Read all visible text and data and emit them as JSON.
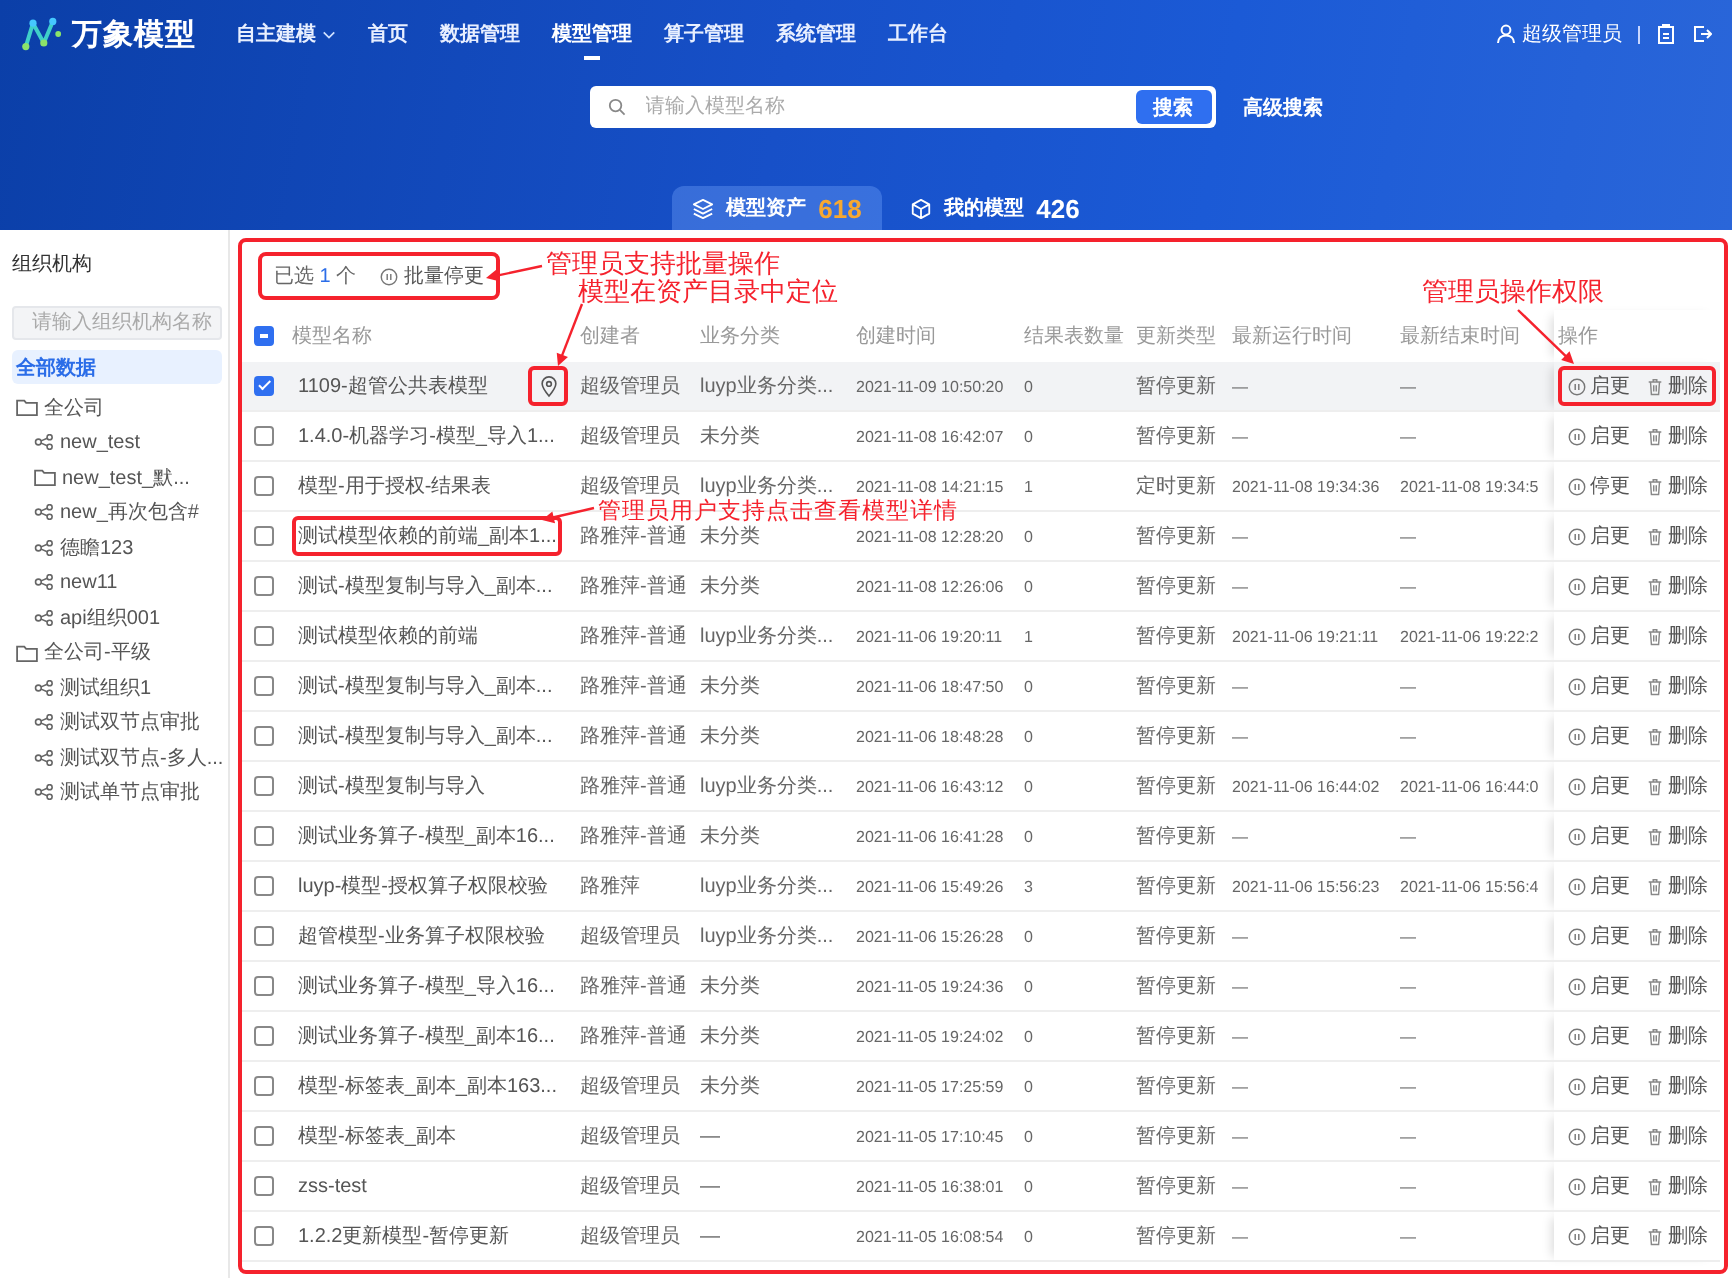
{
  "header": {
    "brand": "万象模型",
    "nav": [
      {
        "label": "自主建模",
        "dropdown": true,
        "selected": false
      },
      {
        "label": "首页",
        "dropdown": false,
        "selected": false
      },
      {
        "label": "数据管理",
        "dropdown": false,
        "selected": false
      },
      {
        "label": "模型管理",
        "dropdown": false,
        "selected": true
      },
      {
        "label": "算子管理",
        "dropdown": false,
        "selected": false
      },
      {
        "label": "系统管理",
        "dropdown": false,
        "selected": false
      },
      {
        "label": "工作台",
        "dropdown": false,
        "selected": false
      }
    ],
    "user": "超级管理员"
  },
  "search": {
    "placeholder": "请输入模型名称",
    "button": "搜索",
    "advanced": "高级搜索"
  },
  "asset_tabs": [
    {
      "label": "模型资产",
      "count": "618",
      "selected": true
    },
    {
      "label": "我的模型",
      "count": "426",
      "selected": false
    }
  ],
  "sidebar": {
    "title": "组织机构",
    "search_placeholder": "请输入组织机构名称",
    "tree": [
      {
        "label": "全部数据",
        "kind": "all",
        "selected": true
      },
      {
        "label": "全公司",
        "kind": "folder",
        "selected": false,
        "children": [
          {
            "label": "new_test",
            "kind": "org",
            "selected": false
          },
          {
            "label": "new_test_默...",
            "kind": "folder",
            "selected": false
          },
          {
            "label": "new_再次包含#",
            "kind": "org",
            "selected": false
          },
          {
            "label": "德瞻123",
            "kind": "org",
            "selected": false
          },
          {
            "label": "new11",
            "kind": "org",
            "selected": false
          },
          {
            "label": "api组织001",
            "kind": "org",
            "selected": false
          }
        ]
      },
      {
        "label": "全公司-平级",
        "kind": "folder",
        "selected": false,
        "children": [
          {
            "label": "测试组织1",
            "kind": "org",
            "selected": false
          },
          {
            "label": "测试双节点审批",
            "kind": "org",
            "selected": false
          },
          {
            "label": "测试双节点-多人...",
            "kind": "org",
            "selected": false
          },
          {
            "label": "测试单节点审批",
            "kind": "org",
            "selected": false
          }
        ]
      }
    ]
  },
  "batch": {
    "prefix": "已选",
    "count": "1",
    "suffix": "个",
    "button": "批量停更",
    "highlighted": true
  },
  "table": {
    "select_all": {
      "indeterminate": true
    },
    "columns": [
      "模型名称",
      "创建者",
      "业务分类",
      "创建时间",
      "结果表数量",
      "更新类型",
      "最新运行时间",
      "最新结束时间",
      "操作"
    ],
    "rows": [
      {
        "selected": true,
        "name": "1109-超管公共表模型",
        "locate": true,
        "name_highlighted": false,
        "creator": "超级管理员",
        "category": "luyp业务分类...",
        "created": "2021-11-09 10:50:20",
        "result_count": "0",
        "update_type": "暂停更新",
        "last_run": "—",
        "last_end": "—",
        "actions": [
          "启更",
          "删除"
        ],
        "actions_highlighted": true
      },
      {
        "selected": false,
        "name": "1.4.0-机器学习-模型_导入1...",
        "locate": false,
        "name_highlighted": false,
        "creator": "超级管理员",
        "category": "未分类",
        "created": "2021-11-08 16:42:07",
        "result_count": "0",
        "update_type": "暂停更新",
        "last_run": "—",
        "last_end": "—",
        "actions": [
          "启更",
          "删除"
        ],
        "actions_highlighted": false
      },
      {
        "selected": false,
        "name": "模型-用于授权-结果表",
        "locate": false,
        "name_highlighted": false,
        "creator": "超级管理员",
        "category": "luyp业务分类...",
        "created": "2021-11-08 14:21:15",
        "result_count": "1",
        "update_type": "定时更新",
        "last_run": "2021-11-08 19:34:36",
        "last_end": "2021-11-08 19:34:5",
        "actions": [
          "停更",
          "删除"
        ],
        "actions_highlighted": false
      },
      {
        "selected": false,
        "name": "测试模型依赖的前端_副本1...",
        "locate": false,
        "name_highlighted": true,
        "creator": "路雅萍-普通",
        "category": "未分类",
        "created": "2021-11-08 12:28:20",
        "result_count": "0",
        "update_type": "暂停更新",
        "last_run": "—",
        "last_end": "—",
        "actions": [
          "启更",
          "删除"
        ],
        "actions_highlighted": false
      },
      {
        "selected": false,
        "name": "测试-模型复制与导入_副本...",
        "locate": false,
        "name_highlighted": false,
        "creator": "路雅萍-普通",
        "category": "未分类",
        "created": "2021-11-08 12:26:06",
        "result_count": "0",
        "update_type": "暂停更新",
        "last_run": "—",
        "last_end": "—",
        "actions": [
          "启更",
          "删除"
        ],
        "actions_highlighted": false
      },
      {
        "selected": false,
        "name": "测试模型依赖的前端",
        "locate": false,
        "name_highlighted": false,
        "creator": "路雅萍-普通",
        "category": "luyp业务分类...",
        "created": "2021-11-06 19:20:11",
        "result_count": "1",
        "update_type": "暂停更新",
        "last_run": "2021-11-06 19:21:11",
        "last_end": "2021-11-06 19:22:2",
        "actions": [
          "启更",
          "删除"
        ],
        "actions_highlighted": false
      },
      {
        "selected": false,
        "name": "测试-模型复制与导入_副本...",
        "locate": false,
        "name_highlighted": false,
        "creator": "路雅萍-普通",
        "category": "未分类",
        "created": "2021-11-06 18:47:50",
        "result_count": "0",
        "update_type": "暂停更新",
        "last_run": "—",
        "last_end": "—",
        "actions": [
          "启更",
          "删除"
        ],
        "actions_highlighted": false
      },
      {
        "selected": false,
        "name": "测试-模型复制与导入_副本...",
        "locate": false,
        "name_highlighted": false,
        "creator": "路雅萍-普通",
        "category": "未分类",
        "created": "2021-11-06 18:48:28",
        "result_count": "0",
        "update_type": "暂停更新",
        "last_run": "—",
        "last_end": "—",
        "actions": [
          "启更",
          "删除"
        ],
        "actions_highlighted": false
      },
      {
        "selected": false,
        "name": "测试-模型复制与导入",
        "locate": false,
        "name_highlighted": false,
        "creator": "路雅萍-普通",
        "category": "luyp业务分类...",
        "created": "2021-11-06 16:43:12",
        "result_count": "0",
        "update_type": "暂停更新",
        "last_run": "2021-11-06 16:44:02",
        "last_end": "2021-11-06 16:44:0",
        "actions": [
          "启更",
          "删除"
        ],
        "actions_highlighted": false
      },
      {
        "selected": false,
        "name": "测试业务算子-模型_副本16...",
        "locate": false,
        "name_highlighted": false,
        "creator": "路雅萍-普通",
        "category": "未分类",
        "created": "2021-11-06 16:41:28",
        "result_count": "0",
        "update_type": "暂停更新",
        "last_run": "—",
        "last_end": "—",
        "actions": [
          "启更",
          "删除"
        ],
        "actions_highlighted": false
      },
      {
        "selected": false,
        "name": "luyp-模型-授权算子权限校验",
        "locate": false,
        "name_highlighted": false,
        "creator": "路雅萍",
        "category": "luyp业务分类...",
        "created": "2021-11-06 15:49:26",
        "result_count": "3",
        "update_type": "暂停更新",
        "last_run": "2021-11-06 15:56:23",
        "last_end": "2021-11-06 15:56:4",
        "actions": [
          "启更",
          "删除"
        ],
        "actions_highlighted": false
      },
      {
        "selected": false,
        "name": "超管模型-业务算子权限校验",
        "locate": false,
        "name_highlighted": false,
        "creator": "超级管理员",
        "category": "luyp业务分类...",
        "created": "2021-11-06 15:26:28",
        "result_count": "0",
        "update_type": "暂停更新",
        "last_run": "—",
        "last_end": "—",
        "actions": [
          "启更",
          "删除"
        ],
        "actions_highlighted": false
      },
      {
        "selected": false,
        "name": "测试业务算子-模型_导入16...",
        "locate": false,
        "name_highlighted": false,
        "creator": "路雅萍-普通",
        "category": "未分类",
        "created": "2021-11-05 19:24:36",
        "result_count": "0",
        "update_type": "暂停更新",
        "last_run": "—",
        "last_end": "—",
        "actions": [
          "启更",
          "删除"
        ],
        "actions_highlighted": false
      },
      {
        "selected": false,
        "name": "测试业务算子-模型_副本16...",
        "locate": false,
        "name_highlighted": false,
        "creator": "路雅萍-普通",
        "category": "未分类",
        "created": "2021-11-05 19:24:02",
        "result_count": "0",
        "update_type": "暂停更新",
        "last_run": "—",
        "last_end": "—",
        "actions": [
          "启更",
          "删除"
        ],
        "actions_highlighted": false
      },
      {
        "selected": false,
        "name": "模型-标签表_副本_副本163...",
        "locate": false,
        "name_highlighted": false,
        "creator": "超级管理员",
        "category": "未分类",
        "created": "2021-11-05 17:25:59",
        "result_count": "0",
        "update_type": "暂停更新",
        "last_run": "—",
        "last_end": "—",
        "actions": [
          "启更",
          "删除"
        ],
        "actions_highlighted": false
      },
      {
        "selected": false,
        "name": "模型-标签表_副本",
        "locate": false,
        "name_highlighted": false,
        "creator": "超级管理员",
        "category": "—",
        "created": "2021-11-05 17:10:45",
        "result_count": "0",
        "update_type": "暂停更新",
        "last_run": "—",
        "last_end": "—",
        "actions": [
          "启更",
          "删除"
        ],
        "actions_highlighted": false
      },
      {
        "selected": false,
        "name": "zss-test",
        "locate": false,
        "name_highlighted": false,
        "creator": "超级管理员",
        "category": "—",
        "created": "2021-11-05 16:38:01",
        "result_count": "0",
        "update_type": "暂停更新",
        "last_run": "—",
        "last_end": "—",
        "actions": [
          "启更",
          "删除"
        ],
        "actions_highlighted": false
      },
      {
        "selected": false,
        "name": "1.2.2更新模型-暂停更新",
        "locate": false,
        "name_highlighted": false,
        "creator": "超级管理员",
        "category": "—",
        "created": "2021-11-05 16:08:54",
        "result_count": "0",
        "update_type": "暂停更新",
        "last_run": "—",
        "last_end": "—",
        "actions": [
          "启更",
          "删除"
        ],
        "actions_highlighted": false
      }
    ]
  },
  "annotations": [
    {
      "text": "管理员支持批量操作"
    },
    {
      "text": "模型在资产目录中定位"
    },
    {
      "text": "管理员操作权限"
    },
    {
      "text": "管理员用户支持点击查看模型详情"
    }
  ]
}
